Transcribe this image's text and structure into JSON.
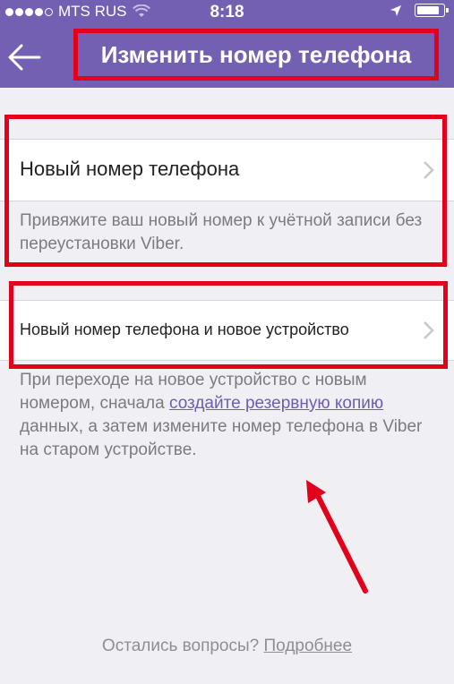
{
  "status_bar": {
    "carrier": "MTS RUS",
    "time": "8:18"
  },
  "nav": {
    "title": "Изменить номер телефона"
  },
  "option1": {
    "label": "Новый номер телефона",
    "description": "Привяжите ваш новый номер к учётной записи без переустановки Viber."
  },
  "option2": {
    "label": "Новый номер телефона и новое устройство",
    "description_part1": "При переходе на новое устройство с новым номером, сначала ",
    "description_link": "создайте резервную копию",
    "description_part2": " данных, а затем измените номер телефона в Viber на старом устройстве."
  },
  "footer": {
    "question": "Остались вопросы? ",
    "link": "Подробнее"
  },
  "colors": {
    "header_bg": "#7360b3",
    "highlight": "#e3001b",
    "link": "#6f5db3",
    "page_bg": "#efeff4"
  }
}
